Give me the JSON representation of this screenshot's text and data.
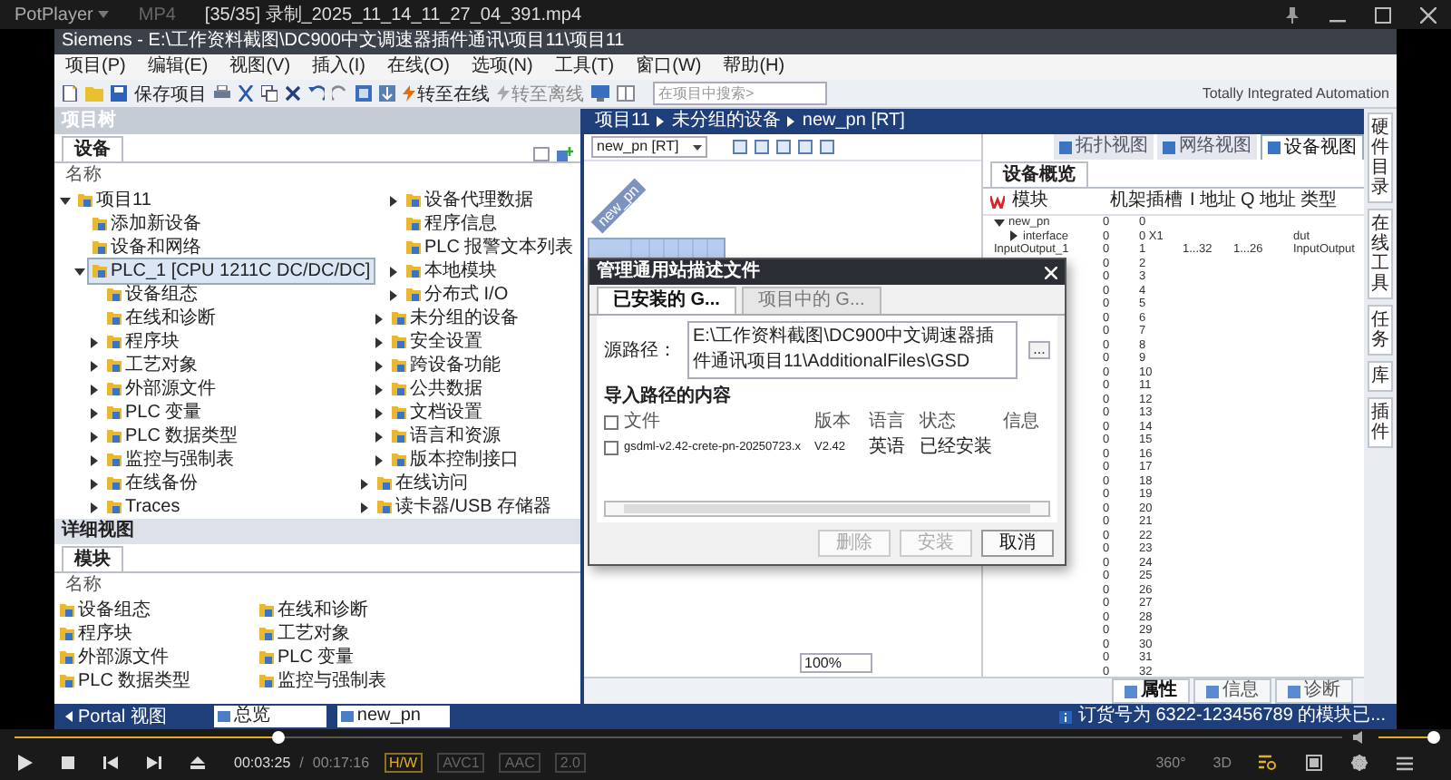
{
  "player": {
    "app_name": "PotPlayer",
    "format": "MP4",
    "file_title": "[35/35] 录制_2025_11_14_11_27_04_391.mp4",
    "seek": {
      "level": 0.198
    },
    "volume": {
      "level": 0.95
    },
    "time_current": "00:03:25",
    "time_separator": "/",
    "time_total": "00:17:16",
    "badges": [
      {
        "label": "H/W",
        "active": true
      },
      {
        "label": "AVC1",
        "active": false
      },
      {
        "label": "AAC",
        "active": false
      },
      {
        "label": "2.0",
        "active": false
      }
    ],
    "view_buttons": [
      "360°",
      "3D"
    ]
  },
  "tia": {
    "title": "Siemens - E:\\工作资料截图\\DC900中文调速器插件通讯\\项目11\\项目11",
    "menu": [
      "项目(P)",
      "编辑(E)",
      "视图(V)",
      "插入(I)",
      "在线(O)",
      "选项(N)",
      "工具(T)",
      "窗口(W)",
      "帮助(H)"
    ],
    "toolbar": {
      "save": "保存项目",
      "go_online": "转至在线",
      "go_offline": "转至离线",
      "search_placeholder": "在项目中搜索>"
    },
    "brand": "Totally Integrated Automation",
    "project_tree": {
      "title": "项目树",
      "tab": "设备",
      "column": "名称",
      "items": [
        {
          "label": "项目11",
          "expanded": true,
          "selected": false,
          "children": [
            {
              "label": "添加新设备",
              "selected": false
            },
            {
              "label": "设备和网络",
              "selected": false
            },
            {
              "label": "PLC_1 [CPU 1211C DC/DC/DC]",
              "expanded": true,
              "selected": true,
              "children": [
                {
                  "label": "设备组态",
                  "selected": false
                },
                {
                  "label": "在线和诊断",
                  "selected": false
                },
                {
                  "label": "程序块",
                  "expanded": false,
                  "selected": false
                },
                {
                  "label": "工艺对象",
                  "expanded": false,
                  "selected": false
                },
                {
                  "label": "外部源文件",
                  "expanded": false,
                  "selected": false
                },
                {
                  "label": "PLC 变量",
                  "expanded": false,
                  "selected": false
                },
                {
                  "label": "PLC 数据类型",
                  "expanded": false,
                  "selected": false
                },
                {
                  "label": "监控与强制表",
                  "expanded": false,
                  "selected": false
                },
                {
                  "label": "在线备份",
                  "expanded": false,
                  "selected": false
                },
                {
                  "label": "Traces",
                  "expanded": false,
                  "selected": false
                },
                {
                  "label": "设备代理数据",
                  "expanded": false,
                  "selected": false
                },
                {
                  "label": "程序信息",
                  "selected": false
                },
                {
                  "label": "PLC 报警文本列表",
                  "selected": false
                },
                {
                  "label": "本地模块",
                  "expanded": false,
                  "selected": false
                },
                {
                  "label": "分布式 I/O",
                  "expanded": false,
                  "selected": false
                }
              ]
            },
            {
              "label": "未分组的设备",
              "expanded": false,
              "selected": false
            },
            {
              "label": "安全设置",
              "expanded": false,
              "selected": false
            },
            {
              "label": "跨设备功能",
              "expanded": false,
              "selected": false
            },
            {
              "label": "公共数据",
              "expanded": false,
              "selected": false
            },
            {
              "label": "文档设置",
              "expanded": false,
              "selected": false
            },
            {
              "label": "语言和资源",
              "expanded": false,
              "selected": false
            },
            {
              "label": "版本控制接口",
              "expanded": false,
              "selected": false
            }
          ]
        },
        {
          "label": "在线访问",
          "expanded": false,
          "selected": false
        },
        {
          "label": "读卡器/USB 存储器",
          "expanded": false,
          "selected": false
        }
      ]
    },
    "details": {
      "title": "详细视图",
      "tab": "模块",
      "column": "名称",
      "items": [
        "设备组态",
        "在线和诊断",
        "程序块",
        "工艺对象",
        "外部源文件",
        "PLC 变量",
        "PLC 数据类型",
        "监控与强制表"
      ]
    },
    "breadcrumb": [
      "项目11",
      "未分组的设备",
      "new_pn [RT]"
    ],
    "editor": {
      "device_select": "new_pn [RT]",
      "device_label": "new_pn",
      "zoom": "100%"
    },
    "view_tabs": [
      {
        "label": "拓扑视图",
        "selected": false
      },
      {
        "label": "网络视图",
        "selected": false
      },
      {
        "label": "设备视图",
        "selected": true
      }
    ],
    "overview": {
      "tab": "设备概览",
      "columns": [
        "模块",
        "机架",
        "插槽",
        "I 地址",
        "Q 地址",
        "类型"
      ],
      "rows": [
        {
          "module": "new_pn",
          "expanded": true,
          "rack": "0",
          "slot": "0",
          "children": [
            {
              "module": "interface",
              "expanded": false,
              "rack": "0",
              "slot": "0 X1",
              "type": "dut"
            }
          ]
        },
        {
          "module": "InputOutput_1",
          "rack": "0",
          "slot": "1",
          "i_addr": "1...32",
          "q_addr": "1...26",
          "type": "InputOutput"
        },
        {
          "rack": "0",
          "slot": "2"
        },
        {
          "rack": "0",
          "slot": "3"
        },
        {
          "rack": "0",
          "slot": "4"
        },
        {
          "rack": "0",
          "slot": "5"
        },
        {
          "rack": "0",
          "slot": "6"
        },
        {
          "rack": "0",
          "slot": "7"
        },
        {
          "rack": "0",
          "slot": "8"
        },
        {
          "rack": "0",
          "slot": "9"
        },
        {
          "rack": "0",
          "slot": "10"
        },
        {
          "rack": "0",
          "slot": "11"
        },
        {
          "rack": "0",
          "slot": "12"
        },
        {
          "rack": "0",
          "slot": "13"
        },
        {
          "rack": "0",
          "slot": "14"
        },
        {
          "rack": "0",
          "slot": "15"
        },
        {
          "rack": "0",
          "slot": "16"
        },
        {
          "rack": "0",
          "slot": "17"
        },
        {
          "rack": "0",
          "slot": "18"
        },
        {
          "rack": "0",
          "slot": "19"
        },
        {
          "rack": "0",
          "slot": "20"
        },
        {
          "rack": "0",
          "slot": "21"
        },
        {
          "rack": "0",
          "slot": "22"
        },
        {
          "rack": "0",
          "slot": "23"
        },
        {
          "rack": "0",
          "slot": "24"
        },
        {
          "rack": "0",
          "slot": "25"
        },
        {
          "rack": "0",
          "slot": "26"
        },
        {
          "rack": "0",
          "slot": "27"
        },
        {
          "rack": "0",
          "slot": "28"
        },
        {
          "rack": "0",
          "slot": "29"
        },
        {
          "rack": "0",
          "slot": "30"
        },
        {
          "rack": "0",
          "slot": "31"
        },
        {
          "rack": "0",
          "slot": "32"
        }
      ]
    },
    "side_tabs": [
      "硬件目录",
      "在线工具",
      "任务",
      "库",
      "插件"
    ],
    "inspector_tabs": [
      {
        "label": "属性",
        "selected": true
      },
      {
        "label": "信息",
        "selected": false
      },
      {
        "label": "诊断",
        "selected": false
      }
    ],
    "status": {
      "portal": "Portal 视图",
      "tasks": [
        "总览",
        "new_pn"
      ],
      "message": "订货号为 6322-123456789 的模块已..."
    },
    "dialog": {
      "title": "管理通用站描述文件",
      "tabs": [
        {
          "label": "已安装的 G...",
          "selected": true
        },
        {
          "label": "项目中的 G...",
          "selected": false
        }
      ],
      "source_label": "源路径：",
      "source_path": "E:\\工作资料截图\\DC900中文调速器插件通讯项目11\\AdditionalFiles\\GSD",
      "browse": "...",
      "content_title": "导入路径的内容",
      "select_all": {
        "checked": false
      },
      "columns": [
        "文件",
        "版本",
        "语言",
        "状态",
        "信息"
      ],
      "rows": [
        {
          "checked": false,
          "file": "gsdml-v2.42-crete-pn-20250723.x",
          "version": "V2.42",
          "language": "英语",
          "status": "已经安装"
        }
      ],
      "buttons": [
        {
          "label": "删除",
          "disabled": true
        },
        {
          "label": "安装",
          "disabled": true
        },
        {
          "label": "取消",
          "disabled": false
        }
      ]
    }
  }
}
